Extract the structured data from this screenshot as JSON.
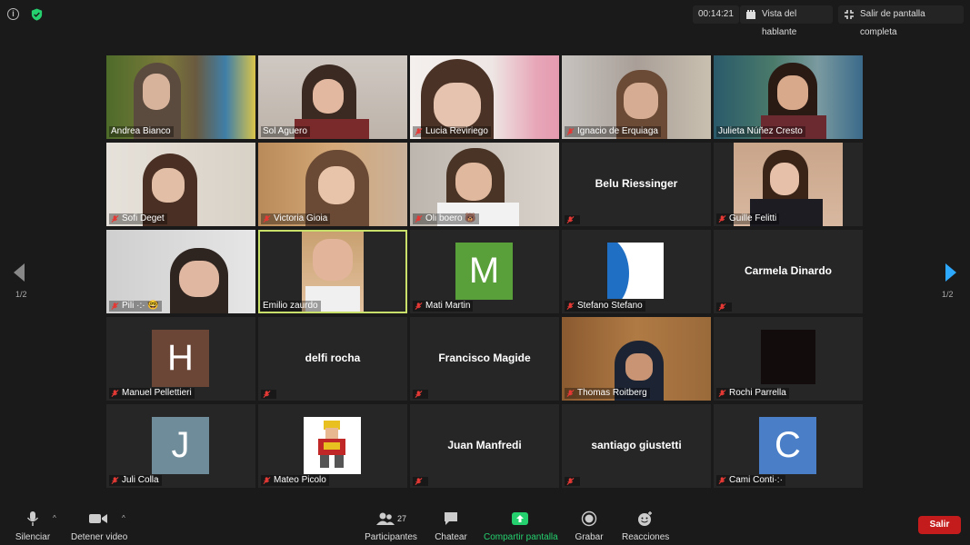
{
  "topbar": {
    "timer": "00:14:21",
    "speaker_view_label": "Vista del hablante",
    "exit_fullscreen_label": "Salir de pantalla completa"
  },
  "navigation": {
    "page_indicator": "1/2"
  },
  "participants": [
    "Andrea Bianco",
    "Sol Aguero",
    "Lucia Reviriego",
    "Ignacio de Erquiaga",
    "Julieta Núñez Cresto",
    "Sofi Deget",
    "Victoria Gioia",
    "Oli boero 🐻",
    "Belu Riessinger",
    "Guille Felitti",
    "Pili ·:· 🤓",
    "Emilio zaurdo",
    "Mati Martin",
    "Stefano Stefano",
    "Carmela Dinardo",
    "Manuel Pellettieri",
    "delfi rocha",
    "Francisco Magide",
    "Thomas Roitberg",
    "Rochi Parrella",
    "Juli Colla",
    "Mateo Picolo",
    "Juan Manfredi",
    "santiago giustetti",
    "Cami Conti·:·"
  ],
  "avatars": {
    "mati": "M",
    "manuel": "H",
    "juli": "J",
    "cami": "C"
  },
  "toolbar": {
    "mute_label": "Silenciar",
    "stop_video_label": "Detener video",
    "participants_label": "Participantes",
    "participants_count": "27",
    "chat_label": "Chatear",
    "share_label": "Compartir pantalla",
    "record_label": "Grabar",
    "reactions_label": "Reacciones",
    "leave_label": "Salir"
  }
}
